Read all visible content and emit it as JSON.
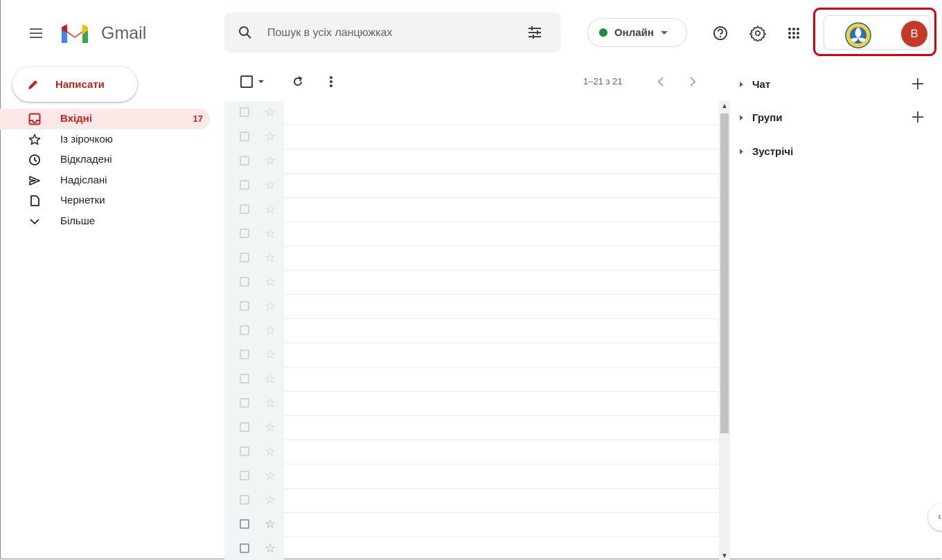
{
  "app": {
    "name": "Gmail"
  },
  "header": {
    "search_placeholder": "Пошук в усіх ланцюжках",
    "status_label": "Онлайн",
    "status_color": "#1e8e3e",
    "avatar_letter": "B",
    "avatar_color": "#c53929",
    "icons": [
      "menu-icon",
      "search-icon",
      "search-options-icon",
      "help-icon",
      "settings-icon",
      "apps-icon"
    ]
  },
  "sidebar": {
    "compose_label": "Написати",
    "items": [
      {
        "label": "Вхідні",
        "count": "17",
        "icon": "inbox-icon"
      },
      {
        "label": "Із зірочкою",
        "count": "",
        "icon": "star-icon"
      },
      {
        "label": "Відкладені",
        "count": "",
        "icon": "clock-icon"
      },
      {
        "label": "Надіслані",
        "count": "",
        "icon": "send-icon"
      },
      {
        "label": "Чернетки",
        "count": "",
        "icon": "draft-icon"
      },
      {
        "label": "Більше",
        "count": "",
        "icon": "chevron-down-icon"
      }
    ]
  },
  "toolbar": {
    "pagination": "1–21 з 21"
  },
  "mail_list": {
    "row_count": 19
  },
  "right_panel": {
    "items": [
      {
        "label": "Чат",
        "has_add": true
      },
      {
        "label": "Групи",
        "has_add": true
      },
      {
        "label": "Зустрічі",
        "has_add": false
      }
    ]
  }
}
